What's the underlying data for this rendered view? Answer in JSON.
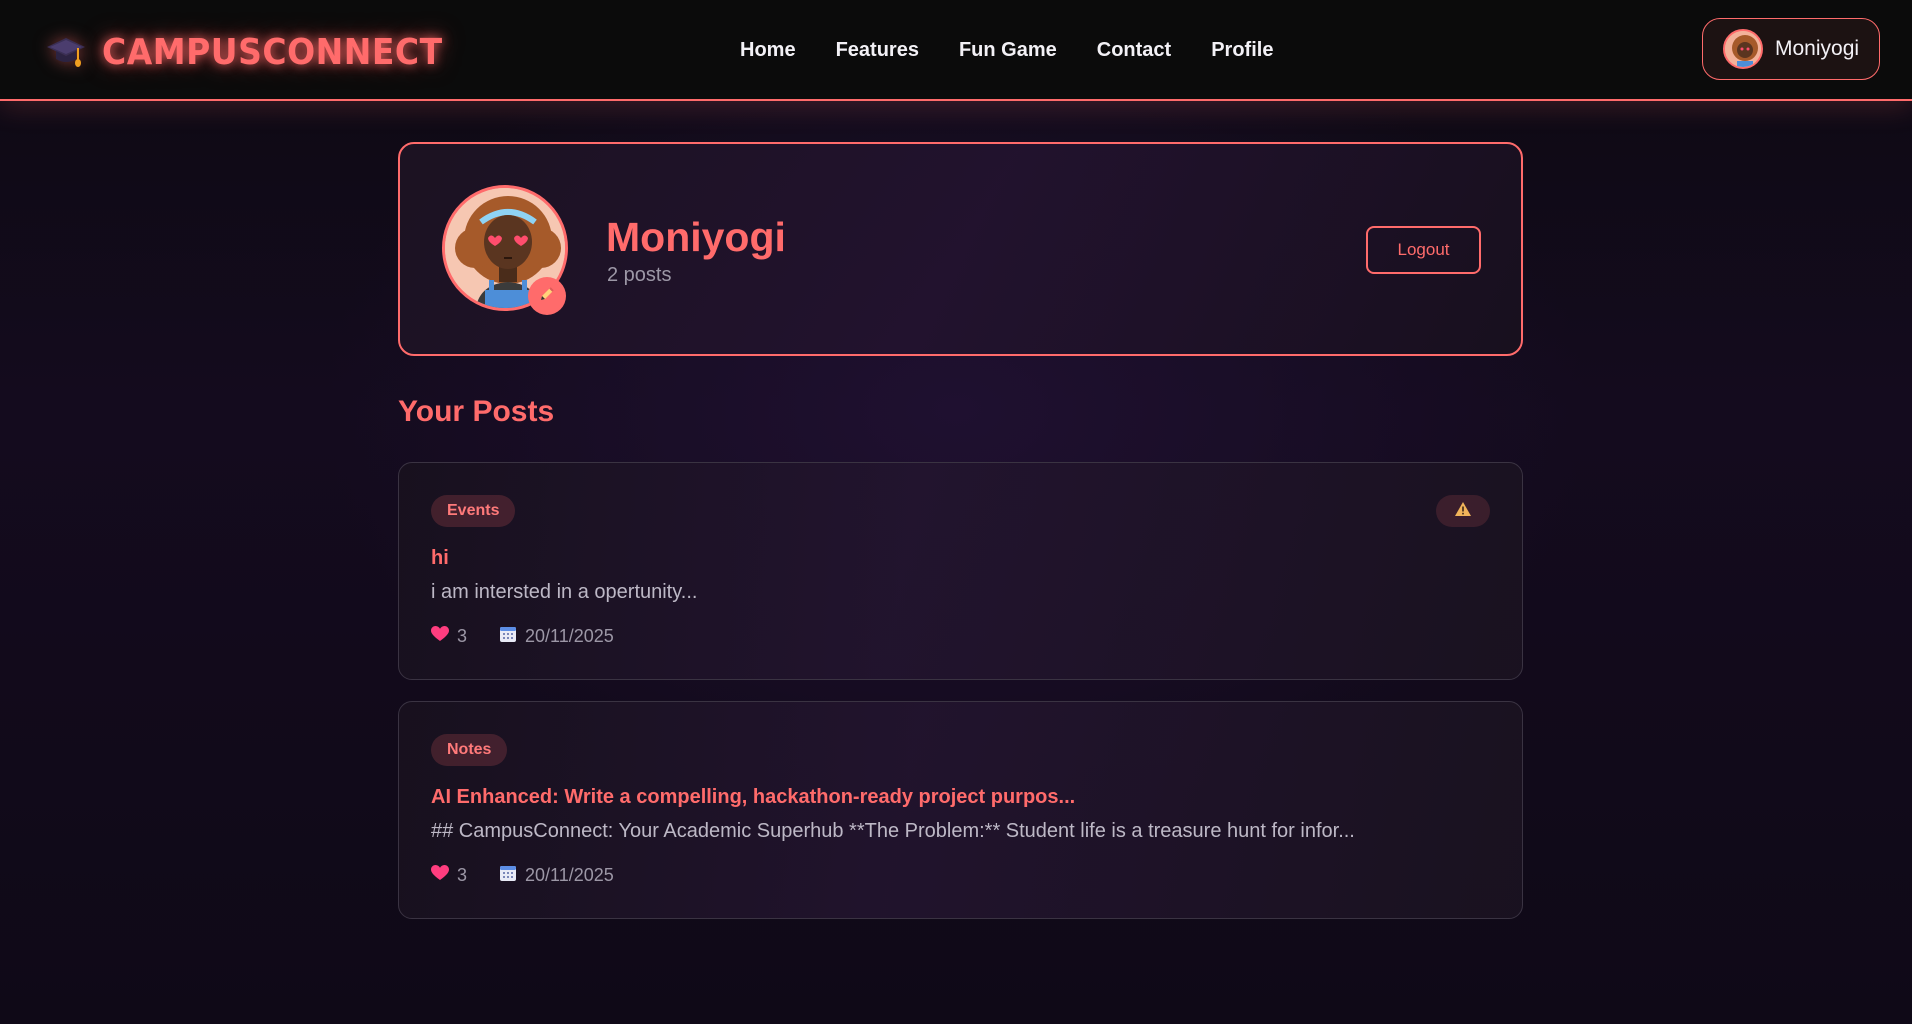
{
  "brand": {
    "name": "CAMPUSCONNECT",
    "icon": "graduation-cap-icon"
  },
  "nav": {
    "links": [
      "Home",
      "Features",
      "Fun Game",
      "Contact",
      "Profile"
    ]
  },
  "user": {
    "name": "Moniyogi"
  },
  "profile": {
    "name": "Moniyogi",
    "post_count": "2 posts",
    "logout_label": "Logout",
    "edit_icon": "pencil-icon"
  },
  "section": {
    "title": "Your Posts"
  },
  "posts": [
    {
      "category": "Events",
      "title": "hi",
      "body": "i am intersted in a opertunity...",
      "likes": "3",
      "date": "20/11/2025",
      "report_icon": "warning-icon"
    },
    {
      "category": "Notes",
      "title": "AI Enhanced: Write a compelling, hackathon-ready project purpos...",
      "body": "## CampusConnect: Your Academic Superhub **The Problem:** Student life is a treasure hunt for infor...",
      "likes": "3",
      "date": "20/11/2025"
    }
  ],
  "colors": {
    "accent": "#ff6b6b",
    "navbar_bg": "#0b0b0b",
    "page_bg": "#140b1e",
    "muted_text": "#9c97a6"
  }
}
